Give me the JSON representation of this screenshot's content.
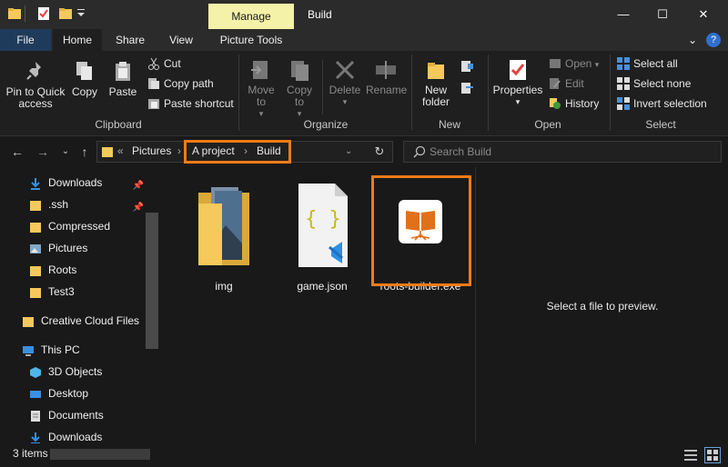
{
  "titlebar": {
    "manage_tab": "Manage",
    "window_title": "Build",
    "minimize": "—",
    "maximize": "☐",
    "close": "✕"
  },
  "ribbon_tabs": {
    "file": "File",
    "home": "Home",
    "share": "Share",
    "view": "View",
    "picture_tools": "Picture Tools",
    "expand": "⌄",
    "help": "?"
  },
  "ribbon": {
    "clipboard": {
      "label": "Clipboard",
      "pin_to_quick_access": "Pin to Quick access",
      "copy": "Copy",
      "paste": "Paste",
      "cut": "Cut",
      "copy_path": "Copy path",
      "paste_shortcut": "Paste shortcut"
    },
    "organize": {
      "label": "Organize",
      "move_to": "Move to",
      "copy_to": "Copy to",
      "delete": "Delete",
      "rename": "Rename"
    },
    "new": {
      "label": "New",
      "new_folder": "New folder"
    },
    "open": {
      "label": "Open",
      "properties": "Properties",
      "open": "Open",
      "edit": "Edit",
      "history": "History"
    },
    "select": {
      "label": "Select",
      "select_all": "Select all",
      "select_none": "Select none",
      "invert_selection": "Invert selection"
    }
  },
  "address": {
    "overflow": "«",
    "crumbs": [
      "Pictures",
      "A project",
      "Build"
    ],
    "separator": "›",
    "search_placeholder": "Search Build"
  },
  "nav": {
    "items": [
      {
        "label": "Downloads",
        "icon": "download-arrow-icon",
        "pinned": true
      },
      {
        "label": ".ssh",
        "icon": "folder-icon",
        "pinned": true
      },
      {
        "label": "Compressed",
        "icon": "folder-icon",
        "pinned": false
      },
      {
        "label": "Pictures",
        "icon": "pictures-icon",
        "pinned": false
      },
      {
        "label": "Roots",
        "icon": "folder-icon",
        "pinned": false
      },
      {
        "label": "Test3",
        "icon": "folder-icon",
        "pinned": false
      },
      {
        "label": "Creative Cloud Files",
        "icon": "folder-icon",
        "pinned": false
      },
      {
        "label": "This PC",
        "icon": "computer-icon",
        "pinned": false
      },
      {
        "label": "3D Objects",
        "icon": "3d-objects-icon",
        "pinned": false
      },
      {
        "label": "Desktop",
        "icon": "desktop-icon",
        "pinned": false
      },
      {
        "label": "Documents",
        "icon": "documents-icon",
        "pinned": false
      },
      {
        "label": "Downloads",
        "icon": "download-arrow-icon",
        "pinned": false
      }
    ]
  },
  "files": [
    {
      "name": "img",
      "icon": "image-folder-icon"
    },
    {
      "name": "game.json",
      "icon": "json-file-icon"
    },
    {
      "name": "roots-builder.exe",
      "icon": "app-book-icon"
    }
  ],
  "preview": {
    "message": "Select a file to preview."
  },
  "status": {
    "item_count": "3 items"
  },
  "colors": {
    "accent_highlight": "#f07b18",
    "manage_tab_bg": "#f4f1a8",
    "file_tab_bg": "#1f3b5b",
    "background": "#191919"
  }
}
